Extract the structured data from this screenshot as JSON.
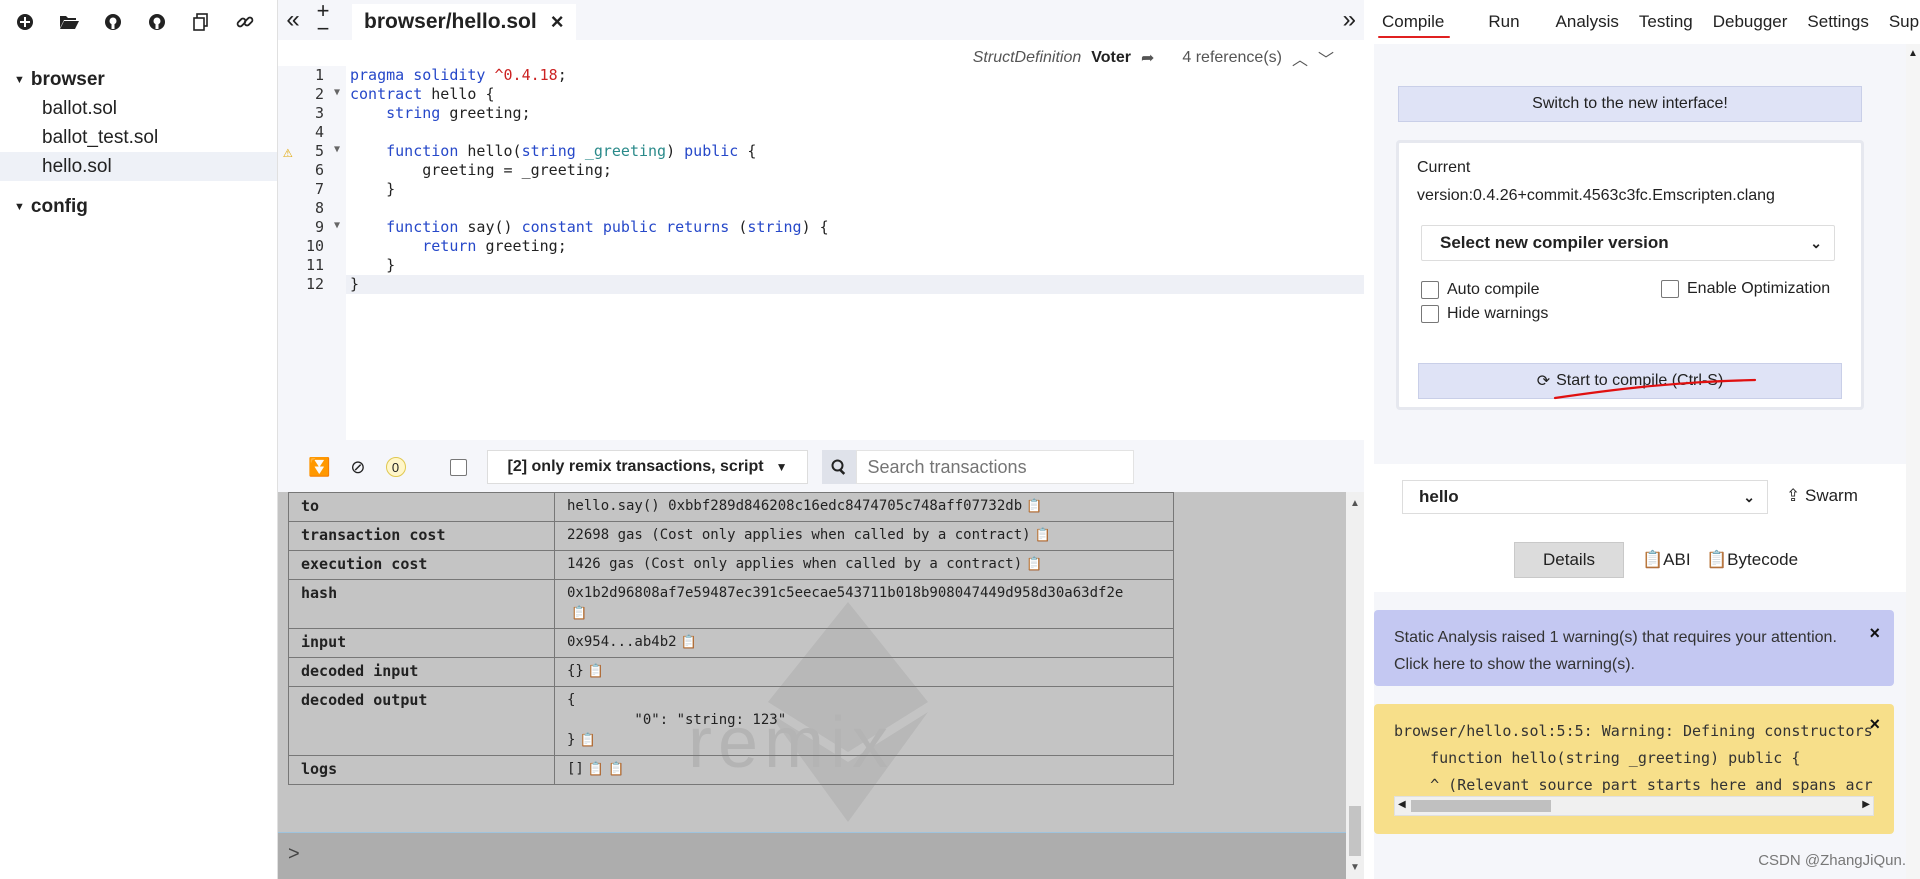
{
  "explorer": {
    "folders": [
      {
        "label": "browser",
        "files": [
          "ballot.sol",
          "ballot_test.sol",
          "hello.sol"
        ]
      },
      {
        "label": "config",
        "files": []
      }
    ],
    "active_file": "hello.sol"
  },
  "editor": {
    "tab_label": "browser/hello.sol",
    "close_glyph": "×",
    "ref_bar": {
      "def_type": "StructDefinition",
      "def_name": "Voter",
      "references": "4 reference(s)"
    },
    "line_numbers": [
      "1",
      "2",
      "3",
      "4",
      "5",
      "6",
      "7",
      "8",
      "9",
      "10",
      "11",
      "12"
    ]
  },
  "terminal": {
    "badge_count": "0",
    "filter_label": "[2] only remix transactions, script",
    "search_placeholder": "Search transactions",
    "rows": [
      {
        "key": "to",
        "value": "hello.say() 0xbbf289d846208c16edc8474705c748aff07732db"
      },
      {
        "key": "transaction cost",
        "value": "22698 gas (Cost only applies when called by a contract)"
      },
      {
        "key": "execution cost",
        "value": "1426 gas (Cost only applies when called by a contract)"
      },
      {
        "key": "hash",
        "value": "0x1b2d96808af7e59487ec391c5eecae543711b018b908047449d958d30a63df2e"
      },
      {
        "key": "input",
        "value": "0x954...ab4b2"
      },
      {
        "key": "decoded input",
        "value": "{}"
      },
      {
        "key": "decoded output",
        "value": "{\n        \"0\": \"string: 123\"\n}"
      },
      {
        "key": "logs",
        "value": "[]"
      }
    ],
    "watermark": "remix",
    "prompt": ">"
  },
  "right_panel": {
    "tabs": [
      "Compile",
      "Run",
      "Analysis",
      "Testing",
      "Debugger",
      "Settings",
      "Support"
    ],
    "active_tab": "Compile",
    "switch_label": "Switch to the new interface!",
    "current_label": "Current",
    "current_version": "version:0.4.26+commit.4563c3fc.Emscripten.clang",
    "select_version_label": "Select new compiler version",
    "auto_compile": "Auto compile",
    "enable_optimization": "Enable Optimization",
    "hide_warnings": "Hide warnings",
    "compile_label": "Start to compile (Ctrl-S)",
    "contract_name": "hello",
    "swarm_label": "Swarm",
    "details_label": "Details",
    "abi_label": "ABI",
    "bytecode_label": "Bytecode",
    "static_warning": "Static Analysis raised 1 warning(s) that requires your attention. Click here to show the warning(s).",
    "compile_warning": "browser/hello.sol:5:5: Warning: Defining constructors\n    function hello(string _greeting) public {\n    ^ (Relevant source part starts here and spans acr"
  },
  "credit": "CSDN @ZhangJiQun."
}
